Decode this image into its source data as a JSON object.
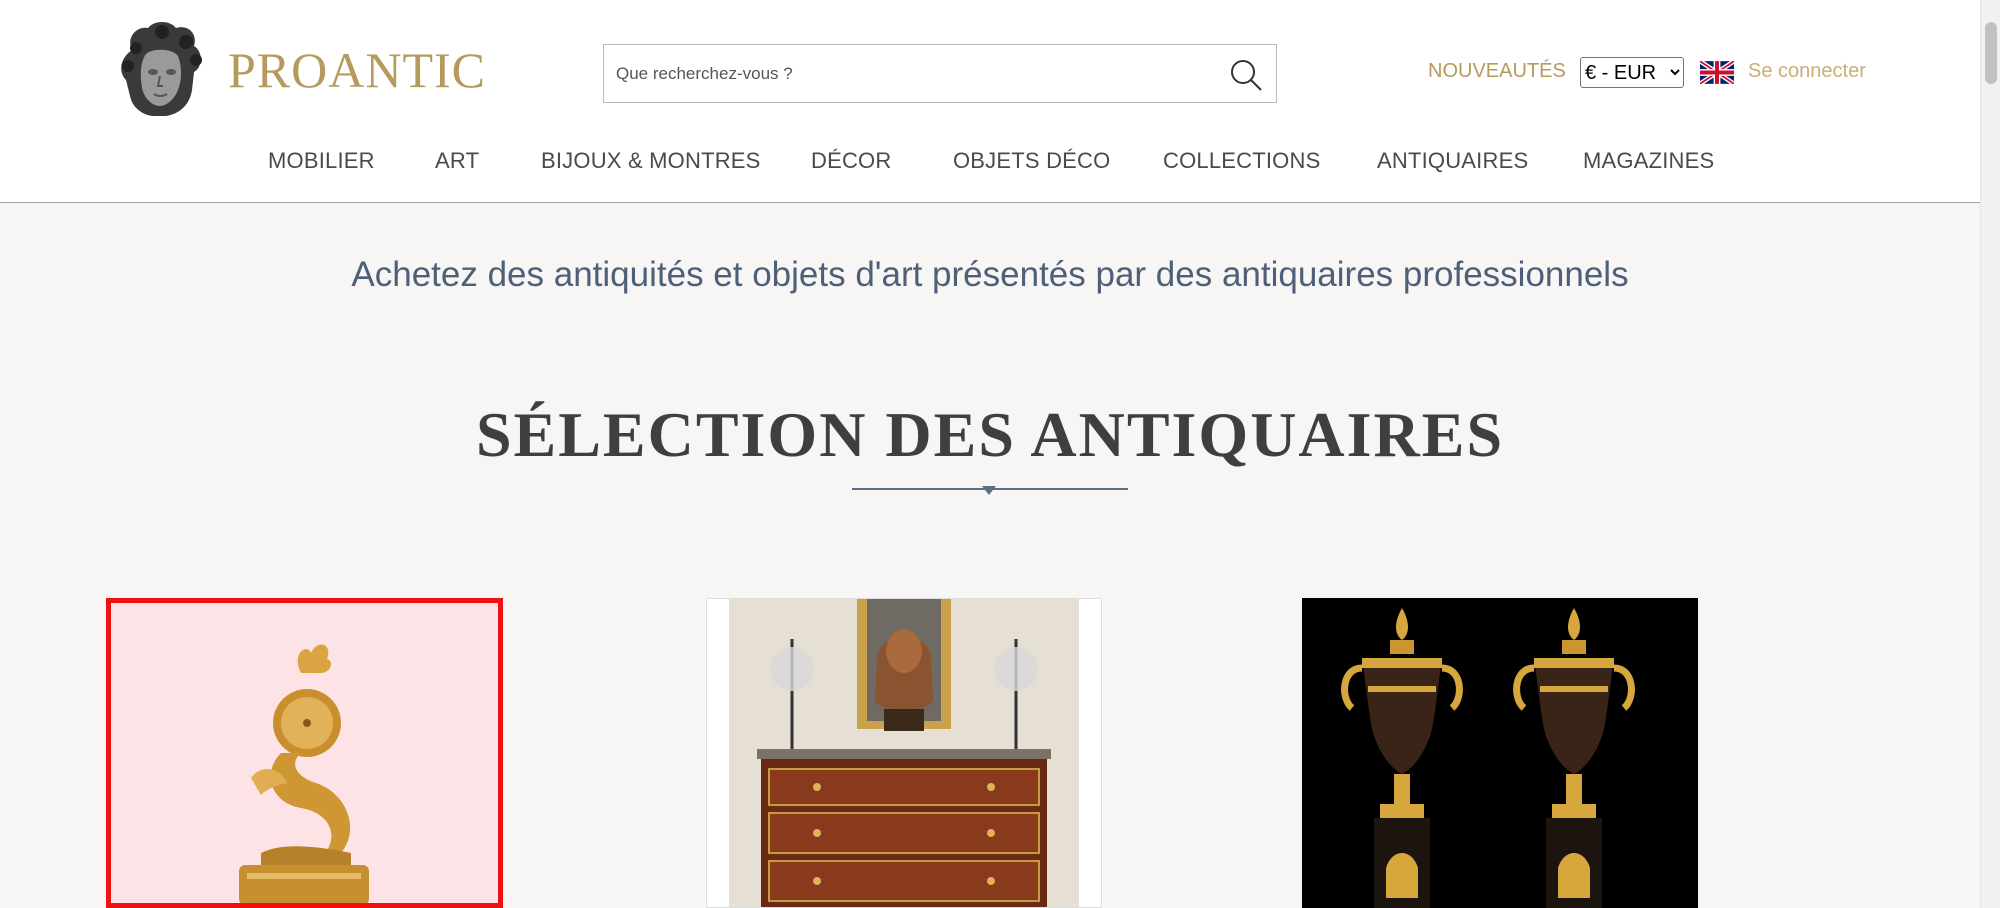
{
  "brand": {
    "name": "PROANTIC",
    "logo_icon": "sculpted-head-logo"
  },
  "search": {
    "placeholder": "Que recherchez-vous ?",
    "icon": "search-icon"
  },
  "header_links": {
    "new": "NOUVEAUTÉS",
    "currency": "€ - EUR",
    "currency_options": [
      "€ - EUR"
    ],
    "language_flag": "uk-flag-icon",
    "login": "Se connecter"
  },
  "nav": {
    "items": [
      {
        "label": "MOBILIER"
      },
      {
        "label": "ART"
      },
      {
        "label": "BIJOUX & MONTRES"
      },
      {
        "label": "DÉCOR"
      },
      {
        "label": "OBJETS DÉCO"
      },
      {
        "label": "COLLECTIONS"
      },
      {
        "label": "ANTIQUAIRES"
      },
      {
        "label": "MAGAZINES"
      }
    ]
  },
  "tagline": "Achetez des antiquités et objets d'art présentés par des antiquaires professionnels",
  "section": {
    "title": "SÉLECTION DES ANTIQUAIRES"
  },
  "products": [
    {
      "image": "gilt-bronze-dolphin-clock",
      "highlighted": true
    },
    {
      "image": "mahogany-commode-with-bust-and-candelabra",
      "highlighted": false
    },
    {
      "image": "pair-of-bronze-and-gilt-vases",
      "highlighted": false
    }
  ],
  "colors": {
    "gold": "#b59a5e",
    "login_gold": "#c9ae7a",
    "tagline_blue": "#4e6079",
    "page_bg": "#f7f6f4",
    "highlight_red": "#ee1111"
  }
}
